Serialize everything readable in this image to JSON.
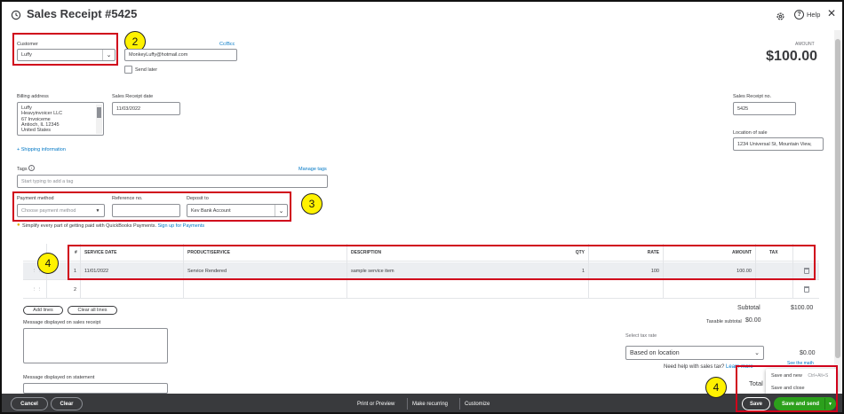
{
  "header": {
    "title": "Sales Receipt #5425",
    "help_label": "Help",
    "amount_label": "AMOUNT",
    "amount_value": "$100.00"
  },
  "customer": {
    "label": "Customer",
    "value": "Luffy",
    "email": "MonkeyLuffy@hotmail.com",
    "cc_bcc": "Cc/Bcc",
    "send_later": "Send later"
  },
  "billing": {
    "label": "Billing address",
    "lines": [
      "Luffy",
      "Heavyinvoicer LLC",
      "67 Invoiceme",
      "Antioch, IL 12345",
      "United States"
    ],
    "shipping_link": "+ Shipping information"
  },
  "receipt_date": {
    "label": "Sales Receipt date",
    "value": "11/03/2022"
  },
  "receipt_no": {
    "label": "Sales Receipt no.",
    "value": "5425"
  },
  "location": {
    "label": "Location of sale",
    "value": "1234 Universal St, Mountain View,"
  },
  "tags": {
    "label": "Tags",
    "manage": "Manage tags",
    "placeholder": "Start typing to add a tag"
  },
  "payment": {
    "method_label": "Payment method",
    "method_placeholder": "Choose payment method",
    "reference_label": "Reference no.",
    "deposit_label": "Deposit to",
    "deposit_value": "Kev Bank Account",
    "promo_text": "Simplify every part of getting paid with QuickBooks Payments.",
    "promo_link": "Sign up for Payments"
  },
  "table": {
    "headers": {
      "num": "#",
      "service_date": "SERVICE DATE",
      "product": "PRODUCT/SERVICE",
      "description": "DESCRIPTION",
      "qty": "QTY",
      "rate": "RATE",
      "amount": "AMOUNT",
      "tax": "TAX"
    },
    "rows": [
      {
        "num": "1",
        "service_date": "11/01/2022",
        "product": "Service Rendered",
        "description": "sample service item",
        "qty": "1",
        "rate": "100",
        "amount": "100.00"
      },
      {
        "num": "2",
        "service_date": "",
        "product": "",
        "description": "",
        "qty": "",
        "rate": "",
        "amount": ""
      }
    ]
  },
  "lines": {
    "add": "Add lines",
    "clear": "Clear all lines"
  },
  "messages": {
    "receipt_label": "Message displayed on sales receipt",
    "statement_label": "Message displayed on statement"
  },
  "totals": {
    "subtotal_label": "Subtotal",
    "subtotal_value": "$100.00",
    "taxable_label": "Taxable subtotal",
    "taxable_value": "$0.00",
    "tax_rate_label": "Select tax rate",
    "tax_rate_value": "Based on location",
    "tax_value": "$0.00",
    "help_text": "Need help with sales tax?",
    "learn_more": "Learn more",
    "see_math": "See the math",
    "total_label": "Total"
  },
  "popup": {
    "save_new": "Save and new",
    "save_new_shortcut": "Ctrl+Alt+S",
    "save_close": "Save and close"
  },
  "footer": {
    "cancel": "Cancel",
    "clear": "Clear",
    "print": "Print or Preview",
    "recurring": "Make recurring",
    "customize": "Customize",
    "save": "Save",
    "save_send": "Save and send"
  },
  "callouts": {
    "c1": "2",
    "c2": "3",
    "c3": "4",
    "c4": "4"
  },
  "colors": {
    "accent_green": "#2ca01c",
    "footer_bg": "#393a3d",
    "link_blue": "#0077c5",
    "highlight_red": "#d0021b",
    "callout_yellow": "#fff200"
  }
}
